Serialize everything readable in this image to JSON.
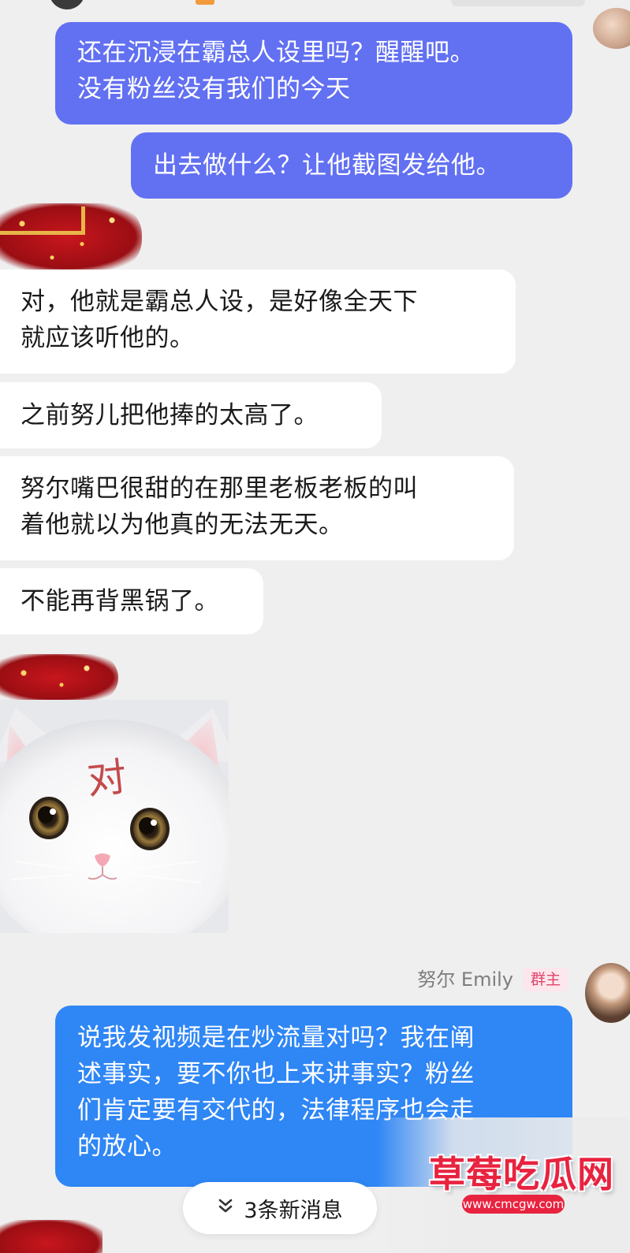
{
  "messages": [
    {
      "side": "out",
      "text": "还在沉浸在霸总人设里吗？醒醒吧。\n没有粉丝没有我们的今天"
    },
    {
      "side": "out",
      "text": "出去做什么？让他截图发给他。"
    },
    {
      "side": "in",
      "text": "对，他就是霸总人设，是好像全天下\n就应该听他的。"
    },
    {
      "side": "in",
      "text": "之前努儿把他捧的太高了。"
    },
    {
      "side": "in",
      "text": "努尔嘴巴很甜的在那里老板老板的叫\n着他就以为他真的无法无天。"
    },
    {
      "side": "in",
      "text": "不能再背黑锅了。"
    },
    {
      "side": "out",
      "text": "说我发视频是在炒流量对吗？我在阐\n述事实，要不你也上来讲事实？粉丝\n们肯定要有交代的，法律程序也会走\n的放心。"
    }
  ],
  "sticker": {
    "caption": "对"
  },
  "sender": {
    "name": "努尔 Emily",
    "badge": "群主"
  },
  "new_messages": {
    "label": "3条新消息",
    "icon": "double-chevron-down-icon"
  },
  "watermark": {
    "title": "草莓吃瓜网",
    "url": "www.cmcgw.com"
  },
  "colors": {
    "outgoing": "#6270f2",
    "outgoing_latest": "#2f86f5",
    "incoming": "#ffffff",
    "background": "#efefef"
  }
}
